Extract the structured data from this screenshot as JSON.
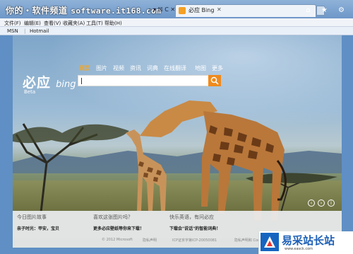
{
  "window": {
    "watermark_cn": "你的・软件频道",
    "watermark_url": "software.it168.com",
    "address_tools": "⌕ ▾ ☒ C ✕",
    "tab_title": "必应 Bing",
    "tab_close": "✕",
    "win_icons": "⌂ ★ ⚙"
  },
  "menubar": {
    "items": [
      "文件(F)",
      "编辑(E)",
      "查看(V)",
      "收藏夹(A)",
      "工具(T)",
      "帮助(H)"
    ]
  },
  "favorites_bar": {
    "items": [
      "MSN",
      "Hotmail"
    ]
  },
  "bing": {
    "logo_cn": "必应",
    "logo_en": "bing",
    "logo_beta": "Beta",
    "search_tabs": [
      "网页",
      "图片",
      "视频",
      "资讯",
      "词典",
      "在线翻译",
      "地图",
      "更多"
    ],
    "active_tab": "网页",
    "search_value": ""
  },
  "bottom_panel": {
    "col1_title": "今日图片故事",
    "col1_desc": "亲子时光：甲安，宝贝",
    "col2_title": "喜欢这张图片吗？",
    "col2_desc": "更多必应壁纸等你来下载！",
    "col3_title": "快乐英语，有问必应",
    "col3_desc": "下载会\"说话\"的智能词典！"
  },
  "footer": {
    "copyright": "© 2012 Microsoft",
    "privacy": "隐私声明",
    "icp": "ICP证京字第ICP-20050081",
    "info": "隐私声明和 Cookie"
  },
  "site_badge": {
    "name": "易采站长站",
    "url": "www.easck.com"
  },
  "colors": {
    "accent": "#f08a1c",
    "window_frame": "#6d97c8",
    "badge_blue": "#1565c0"
  }
}
